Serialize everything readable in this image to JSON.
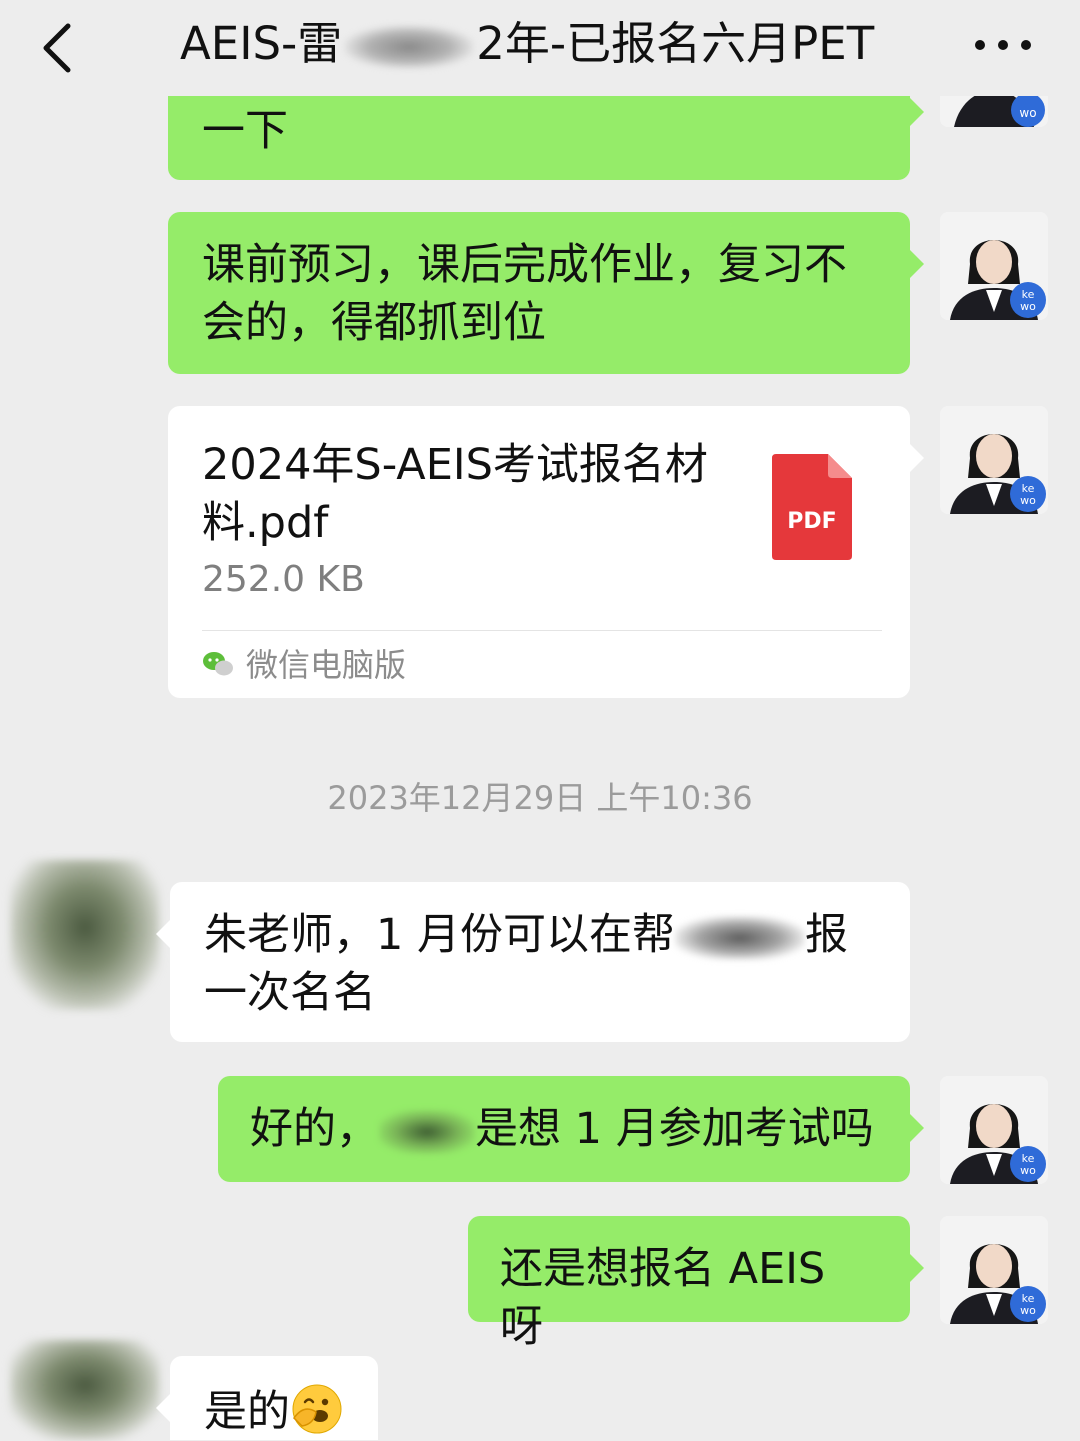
{
  "header": {
    "title_prefix": "AEIS-雷",
    "title_suffix": "2年-已报名六月PET"
  },
  "messages": [
    {
      "text": "一下"
    },
    {
      "text": "课前预习，课后完成作业，复习不会的，得都抓到位"
    },
    {
      "file": {
        "name": "2024年S-AEIS考试报名材料.pdf",
        "size": "252.0 KB",
        "source": "微信电脑版",
        "icon_label": "PDF"
      }
    },
    {
      "timestamp": "2023年12月29日 上午10:36"
    },
    {
      "text_before": "朱老师，1 月份可以在帮",
      "text_after": "报一次名名"
    },
    {
      "text_before": "好的，",
      "text_after": "是想 1 月参加考试吗"
    },
    {
      "text": "还是想报名 AEIS 呀"
    },
    {
      "text": "是的",
      "emoji": "face-with-hand-over-mouth"
    }
  ],
  "avatar": {
    "badge": "ke wo",
    "badge_color": "#2F6BD8"
  },
  "colors": {
    "sent_bubble": "#95EC69",
    "received_bubble": "#FFFFFF",
    "background": "#EDEDED",
    "pdf_red": "#E5383B"
  }
}
